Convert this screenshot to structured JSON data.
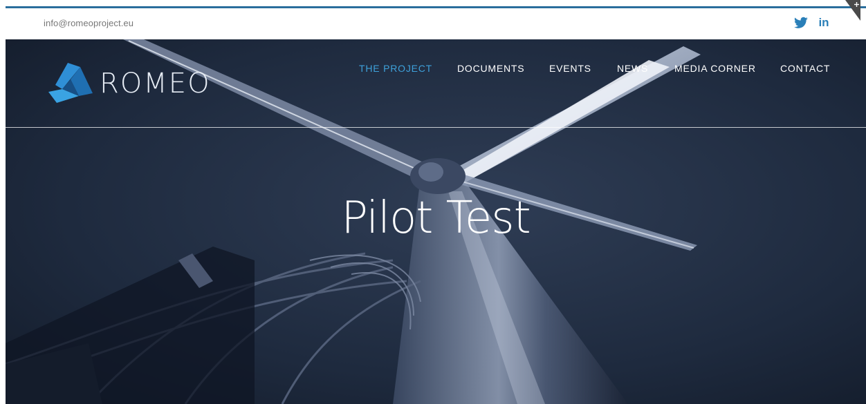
{
  "topbar": {
    "email": "info@romeoproject.eu",
    "social": [
      {
        "name": "twitter",
        "icon": "twitter-icon"
      },
      {
        "name": "linkedin",
        "icon": "linkedin-icon",
        "text": "in"
      }
    ],
    "corner_tab_icon": "plus-icon"
  },
  "header": {
    "logo_text": "ROMEO",
    "nav": [
      {
        "label": "THE PROJECT",
        "active": true
      },
      {
        "label": "DOCUMENTS",
        "active": false
      },
      {
        "label": "EVENTS",
        "active": false
      },
      {
        "label": "NEWS",
        "active": false
      },
      {
        "label": "MEDIA CORNER",
        "active": false
      },
      {
        "label": "CONTACT",
        "active": false
      }
    ]
  },
  "hero": {
    "title": "Pilot Test",
    "background": "wind-turbine-photo"
  },
  "colors": {
    "accent": "#2a6e9c",
    "nav_active": "#3ea1db",
    "hero_bg": "#1a2334",
    "logo_blue": "#2f8fd6"
  }
}
